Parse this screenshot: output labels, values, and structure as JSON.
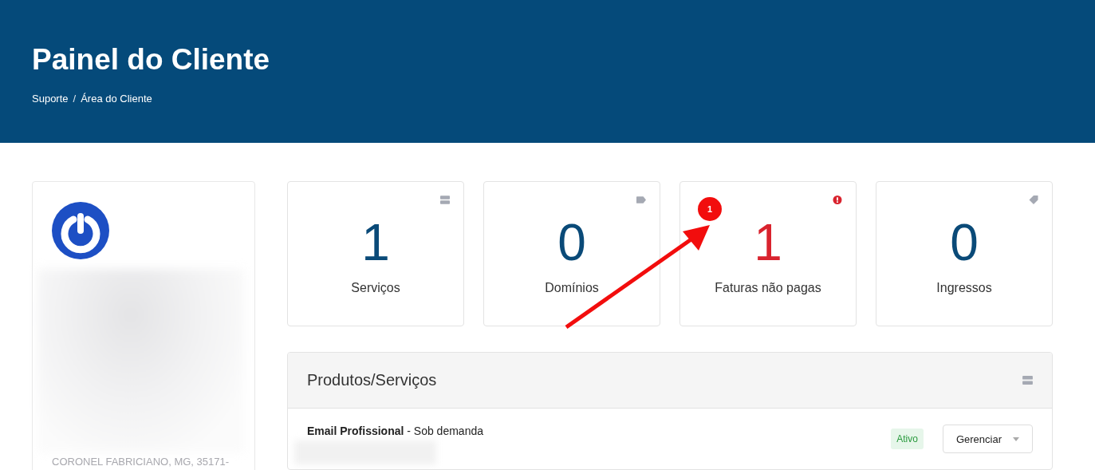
{
  "header": {
    "title": "Painel do Cliente",
    "breadcrumb": [
      "Suporte",
      "Área do Cliente"
    ],
    "separator": "/"
  },
  "sidebar": {
    "address_line": "CORONEL FABRICIANO, MG, 35171-"
  },
  "stats": [
    {
      "value": "1",
      "label": "Serviços",
      "kind": "server",
      "alert": false
    },
    {
      "value": "0",
      "label": "Domínios",
      "kind": "tag",
      "alert": false
    },
    {
      "value": "1",
      "label": "Faturas não pagas",
      "kind": "exclamation",
      "alert": true
    },
    {
      "value": "0",
      "label": "Ingressos",
      "kind": "ticket",
      "alert": false
    }
  ],
  "annotation": {
    "badge": "1"
  },
  "products": {
    "title": "Produtos/Serviços",
    "rows": [
      {
        "name": "Email Profissional",
        "cycle": " - Sob demanda",
        "status": "Ativo",
        "action": "Gerenciar"
      }
    ]
  }
}
